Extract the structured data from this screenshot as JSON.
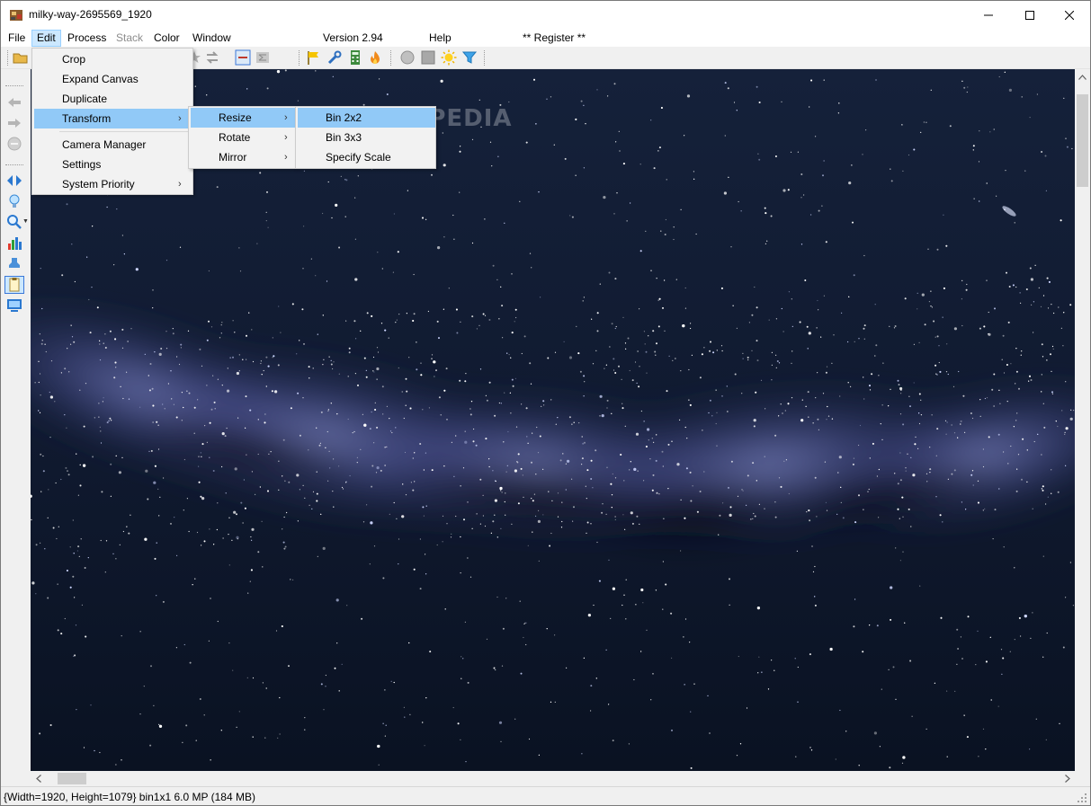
{
  "window": {
    "title": "milky-way-2695569_1920",
    "minimize_glyph": "—",
    "maximize_glyph": "☐",
    "close_glyph": "✕"
  },
  "menubar": {
    "file": "File",
    "edit": "Edit",
    "process": "Process",
    "stack": "Stack",
    "color": "Color",
    "window": "Window",
    "version": "Version 2.94",
    "help": "Help",
    "register": "** Register **"
  },
  "edit_menu": {
    "crop": "Crop",
    "expand_canvas": "Expand Canvas",
    "duplicate": "Duplicate",
    "transform": "Transform",
    "camera_manager": "Camera Manager",
    "settings": "Settings",
    "system_priority": "System Priority",
    "submenu_arrow": "›"
  },
  "transform_menu": {
    "resize": "Resize",
    "rotate": "Rotate",
    "mirror": "Mirror"
  },
  "resize_menu": {
    "bin2x2": "Bin 2x2",
    "bin3x3": "Bin 3x3",
    "specify_scale": "Specify Scale"
  },
  "watermark": "SOFTPEDIA",
  "statusbar": {
    "text": "{Width=1920, Height=1079} bin1x1  6.0 MP (184 MB)"
  },
  "scroll": {
    "left": "<",
    "right": ">",
    "up": "^",
    "down": "v"
  },
  "colors": {
    "menu_highlight": "#91c9f7",
    "menubar_active": "#cce8ff",
    "sky_dark": "#0c1424",
    "milky_way": "#6b73b8"
  },
  "icons": {
    "toolbar": [
      "open-folder-icon",
      "star-icon",
      "swap-arrows-icon",
      "minus-box-icon",
      "sigma-icon",
      "flag-icon",
      "wrench-icon",
      "calculator-icon",
      "flame-icon",
      "circle-icon",
      "square-icon",
      "sun-icon",
      "filter-icon"
    ],
    "left": [
      "back-arrow-icon",
      "forward-arrow-icon",
      "no-entry-icon",
      "pan-arrows-icon",
      "bulb-icon",
      "zoom-icon",
      "histogram-icon",
      "stamp-icon",
      "clipboard-icon",
      "monitor-icon"
    ]
  }
}
